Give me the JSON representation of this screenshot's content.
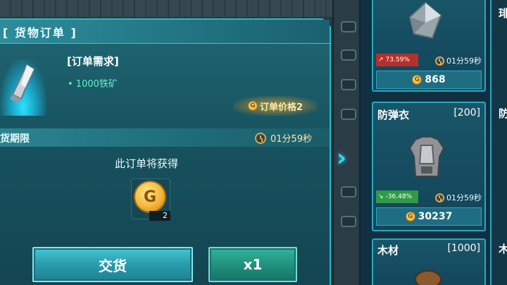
{
  "order_panel": {
    "title": "[ 货物订单 ]",
    "requirement_title": "[订单需求]",
    "requirement_item": "• 1000铁矿",
    "price_label": "订单价格2",
    "deadline_label": "货期限",
    "deadline_time": "01分59秒",
    "earn_title": "此订单将获得",
    "reward": {
      "coin_letter": "G",
      "count": "2"
    },
    "deliver_button": "交货",
    "multiplier_button": "x1"
  },
  "market": {
    "cards": [
      {
        "name": "",
        "level": "",
        "trend": "73.59%",
        "trend_dir": "up",
        "time": "01分59秒",
        "price": "868"
      },
      {
        "name": "防弹衣",
        "level": "[200]",
        "trend": "-36.48%",
        "trend_dir": "down",
        "time": "01分59秒",
        "price": "30237"
      },
      {
        "name": "木材",
        "level": "[1000]",
        "trend": "",
        "trend_dir": "",
        "time": "",
        "price": ""
      }
    ],
    "side_chars": [
      "琲",
      "防",
      "木"
    ]
  },
  "colors": {
    "panel": "#17525e",
    "accent": "#2fb7c5",
    "coin": "#f3b63a",
    "trend_up": "#b5302c",
    "trend_down": "#2f9a48"
  }
}
